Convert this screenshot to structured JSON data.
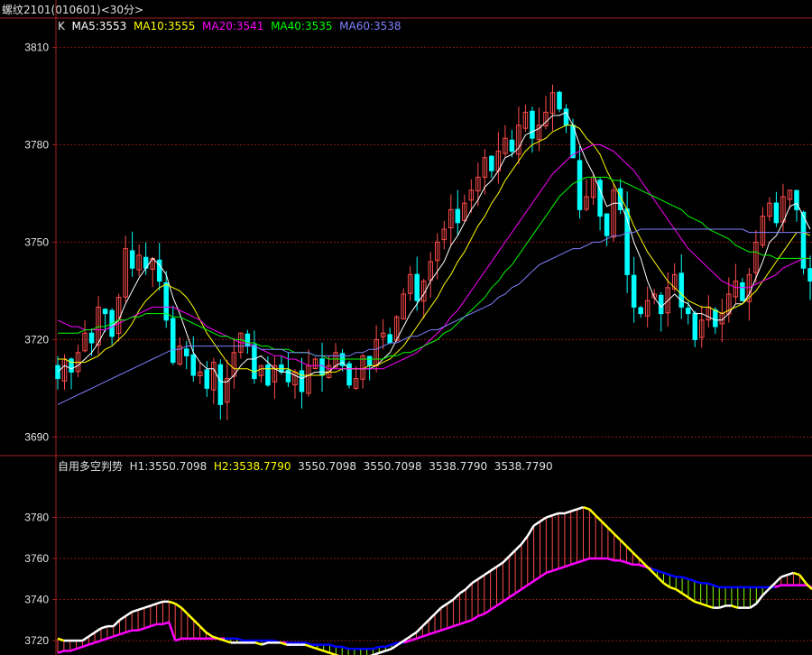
{
  "header": {
    "title": "螺纹2101(010601)<30分>"
  },
  "colors": {
    "up": "#ff4b4b",
    "down": "#00ffff",
    "grid": "#8b1a1a",
    "ma5": "#ffffff",
    "ma10": "#ffff00",
    "ma20": "#ff00ff",
    "ma40": "#00ff00",
    "ma60": "#8080ff"
  },
  "chart_data": [
    {
      "type": "candlestick",
      "legend": {
        "k": "K",
        "ma5": "MA5:3553",
        "ma10": "MA10:3555",
        "ma20": "MA20:3541",
        "ma40": "MA40:3535",
        "ma60": "MA60:3538"
      },
      "yticks": [
        "3810",
        "3780",
        "3750",
        "3720",
        "3690"
      ],
      "ylim": [
        3684,
        3819
      ],
      "close": [
        3708,
        3714,
        3710,
        3716,
        3722,
        3719,
        3730,
        3728,
        3721,
        3733,
        3748,
        3742,
        3746,
        3742,
        3745,
        3738,
        3726,
        3713,
        3718,
        3715,
        3709,
        3710,
        3705,
        3713,
        3700,
        3708,
        3716,
        3722,
        3718,
        3708,
        3712,
        3706,
        3712,
        3710,
        3707,
        3710,
        3704,
        3712,
        3714,
        3709,
        3712,
        3716,
        3712,
        3706,
        3708,
        3715,
        3712,
        3720,
        3722,
        3719,
        3727,
        3734,
        3740,
        3732,
        3738,
        3744,
        3750,
        3754,
        3760,
        3756,
        3762,
        3766,
        3770,
        3776,
        3772,
        3778,
        3782,
        3778,
        3786,
        3790,
        3782,
        3786,
        3790,
        3796,
        3791,
        3786,
        3776,
        3760,
        3764,
        3770,
        3758,
        3752,
        3766,
        3760,
        3740,
        3730,
        3728,
        3732,
        3734,
        3728,
        3736,
        3740,
        3730,
        3728,
        3720,
        3726,
        3730,
        3724,
        3728,
        3734,
        3738,
        3732,
        3740,
        3750,
        3758,
        3762,
        3756,
        3764,
        3766,
        3760,
        3742,
        3738
      ],
      "ma5": [
        3710,
        3712,
        3711,
        3712,
        3714,
        3716,
        3719,
        3723,
        3724,
        3726,
        3731,
        3735,
        3739,
        3742,
        3745,
        3743,
        3740,
        3733,
        3728,
        3722,
        3716,
        3713,
        3711,
        3711,
        3707,
        3707,
        3709,
        3712,
        3714,
        3714,
        3715,
        3713,
        3711,
        3710,
        3710,
        3709,
        3708,
        3709,
        3710,
        3710,
        3710,
        3712,
        3713,
        3711,
        3711,
        3711,
        3711,
        3712,
        3714,
        3716,
        3720,
        3724,
        3728,
        3731,
        3734,
        3738,
        3741,
        3744,
        3749,
        3752,
        3756,
        3760,
        3763,
        3767,
        3769,
        3772,
        3776,
        3777,
        3779,
        3783,
        3784,
        3785,
        3787,
        3789,
        3789,
        3790,
        3786,
        3780,
        3775,
        3771,
        3766,
        3761,
        3762,
        3762,
        3757,
        3750,
        3745,
        3738,
        3733,
        3730,
        3732,
        3734,
        3732,
        3731,
        3728,
        3728,
        3727,
        3726,
        3726,
        3728,
        3731,
        3731,
        3734,
        3739,
        3744,
        3750,
        3752,
        3756,
        3761,
        3762,
        3758,
        3754
      ],
      "ma10": [
        3714,
        3714,
        3713,
        3713,
        3713,
        3714,
        3715,
        3717,
        3718,
        3720,
        3722,
        3725,
        3729,
        3732,
        3734,
        3736,
        3737,
        3736,
        3735,
        3733,
        3730,
        3726,
        3722,
        3719,
        3716,
        3713,
        3711,
        3711,
        3711,
        3710,
        3711,
        3711,
        3711,
        3711,
        3711,
        3710,
        3709,
        3709,
        3709,
        3709,
        3710,
        3710,
        3711,
        3711,
        3711,
        3711,
        3712,
        3712,
        3713,
        3714,
        3716,
        3718,
        3721,
        3724,
        3727,
        3730,
        3733,
        3737,
        3740,
        3744,
        3747,
        3751,
        3755,
        3758,
        3762,
        3765,
        3769,
        3772,
        3775,
        3778,
        3780,
        3781,
        3782,
        3784,
        3785,
        3786,
        3786,
        3785,
        3782,
        3780,
        3777,
        3772,
        3768,
        3764,
        3760,
        3755,
        3751,
        3747,
        3744,
        3741,
        3738,
        3736,
        3734,
        3732,
        3731,
        3730,
        3730,
        3729,
        3728,
        3729,
        3730,
        3731,
        3733,
        3735,
        3738,
        3741,
        3744,
        3747,
        3750,
        3753,
        3753,
        3752
      ],
      "ma20": [
        3726,
        3725,
        3724,
        3724,
        3723,
        3723,
        3723,
        3723,
        3724,
        3725,
        3726,
        3727,
        3728,
        3729,
        3730,
        3730,
        3730,
        3730,
        3729,
        3728,
        3727,
        3726,
        3724,
        3723,
        3722,
        3721,
        3720,
        3719,
        3719,
        3718,
        3717,
        3716,
        3715,
        3715,
        3714,
        3714,
        3713,
        3712,
        3712,
        3712,
        3711,
        3711,
        3711,
        3711,
        3711,
        3711,
        3711,
        3711,
        3711,
        3712,
        3713,
        3714,
        3715,
        3716,
        3718,
        3720,
        3722,
        3724,
        3727,
        3729,
        3732,
        3735,
        3738,
        3741,
        3744,
        3747,
        3750,
        3753,
        3756,
        3759,
        3762,
        3765,
        3768,
        3771,
        3773,
        3775,
        3777,
        3778,
        3779,
        3780,
        3780,
        3779,
        3778,
        3776,
        3774,
        3772,
        3769,
        3766,
        3763,
        3760,
        3757,
        3754,
        3751,
        3748,
        3746,
        3744,
        3742,
        3740,
        3738,
        3737,
        3736,
        3736,
        3736,
        3737,
        3738,
        3739,
        3740,
        3742,
        3743,
        3744,
        3745,
        3745
      ],
      "ma40": [
        3722,
        3722,
        3722,
        3722,
        3723,
        3723,
        3724,
        3724,
        3725,
        3726,
        3726,
        3727,
        3727,
        3728,
        3728,
        3728,
        3728,
        3727,
        3727,
        3726,
        3725,
        3724,
        3723,
        3722,
        3721,
        3721,
        3720,
        3720,
        3719,
        3719,
        3718,
        3718,
        3717,
        3717,
        3717,
        3716,
        3716,
        3716,
        3715,
        3715,
        3714,
        3714,
        3714,
        3714,
        3714,
        3714,
        3714,
        3714,
        3714,
        3715,
        3715,
        3716,
        3716,
        3717,
        3718,
        3719,
        3720,
        3722,
        3723,
        3725,
        3727,
        3729,
        3731,
        3733,
        3736,
        3738,
        3741,
        3743,
        3746,
        3749,
        3752,
        3755,
        3758,
        3761,
        3764,
        3766,
        3768,
        3769,
        3770,
        3770,
        3770,
        3770,
        3769,
        3769,
        3768,
        3767,
        3766,
        3765,
        3764,
        3763,
        3762,
        3761,
        3760,
        3758,
        3757,
        3756,
        3754,
        3753,
        3752,
        3751,
        3749,
        3748,
        3747,
        3747,
        3746,
        3746,
        3745,
        3745,
        3745,
        3745,
        3745,
        3745
      ],
      "ma60": [
        3700,
        3701,
        3702,
        3703,
        3704,
        3705,
        3706,
        3707,
        3708,
        3709,
        3710,
        3711,
        3712,
        3713,
        3714,
        3715,
        3716,
        3717,
        3717,
        3718,
        3718,
        3718,
        3718,
        3718,
        3718,
        3718,
        3718,
        3718,
        3718,
        3718,
        3717,
        3717,
        3717,
        3717,
        3716,
        3716,
        3716,
        3716,
        3715,
        3715,
        3715,
        3715,
        3715,
        3715,
        3716,
        3716,
        3717,
        3717,
        3718,
        3719,
        3719,
        3720,
        3721,
        3721,
        3722,
        3723,
        3723,
        3724,
        3725,
        3726,
        3727,
        3728,
        3729,
        3730,
        3731,
        3733,
        3734,
        3736,
        3737,
        3739,
        3741,
        3743,
        3744,
        3745,
        3746,
        3747,
        3748,
        3748,
        3749,
        3750,
        3750,
        3751,
        3752,
        3752,
        3753,
        3753,
        3754,
        3754,
        3754,
        3754,
        3754,
        3754,
        3754,
        3754,
        3754,
        3754,
        3754,
        3754,
        3754,
        3754,
        3754,
        3754,
        3753,
        3753,
        3753,
        3753,
        3753,
        3753,
        3753,
        3753,
        3753,
        3753
      ]
    },
    {
      "type": "line",
      "legend": {
        "name": "自用多空判势",
        "h1": "H1:3550.7098",
        "h2": "H2:3538.7790",
        "v1": "3550.7098",
        "v2": "3550.7098",
        "v3": "3538.7790",
        "v4": "3538.7790"
      },
      "yticks": [
        "3780",
        "3760",
        "3740",
        "3720"
      ],
      "ylim": [
        3713,
        3800
      ],
      "h1": [
        3721,
        3720,
        3720,
        3720,
        3720,
        3722,
        3724,
        3726,
        3727,
        3727,
        3730,
        3732,
        3734,
        3735,
        3736,
        3737,
        3738,
        3739,
        3739,
        3738,
        3736,
        3733,
        3730,
        3727,
        3724,
        3722,
        3721,
        3720,
        3719,
        3719,
        3719,
        3719,
        3719,
        3718,
        3719,
        3719,
        3719,
        3718,
        3718,
        3718,
        3718,
        3717,
        3716,
        3715,
        3714,
        3713,
        3712,
        3712,
        3711,
        3712,
        3712,
        3713,
        3714,
        3715,
        3716,
        3718,
        3720,
        3722,
        3724,
        3727,
        3730,
        3733,
        3736,
        3738,
        3740,
        3743,
        3745,
        3748,
        3750,
        3752,
        3754,
        3756,
        3758,
        3761,
        3764,
        3767,
        3771,
        3776,
        3778,
        3780,
        3781,
        3782,
        3782,
        3783,
        3784,
        3785,
        3784,
        3781,
        3778,
        3775,
        3772,
        3769,
        3766,
        3763,
        3760,
        3757,
        3754,
        3751,
        3748,
        3746,
        3745,
        3743,
        3741,
        3739,
        3738,
        3737,
        3736,
        3736,
        3737,
        3737,
        3736,
        3736,
        3736,
        3738,
        3742,
        3745,
        3748,
        3751,
        3752,
        3753,
        3752,
        3748,
        3745
      ],
      "h2": [
        3714,
        3715,
        3715,
        3716,
        3717,
        3718,
        3719,
        3720,
        3721,
        3722,
        3723,
        3724,
        3725,
        3725,
        3726,
        3727,
        3728,
        3728,
        3729,
        3720,
        3721,
        3721,
        3721,
        3721,
        3721,
        3721,
        3721,
        3721,
        3721,
        3721,
        3720,
        3720,
        3720,
        3720,
        3720,
        3720,
        3719,
        3719,
        3719,
        3719,
        3719,
        3718,
        3718,
        3718,
        3718,
        3717,
        3717,
        3716,
        3716,
        3716,
        3716,
        3716,
        3717,
        3717,
        3718,
        3719,
        3719,
        3720,
        3721,
        3722,
        3723,
        3724,
        3725,
        3726,
        3727,
        3728,
        3729,
        3730,
        3732,
        3733,
        3735,
        3737,
        3739,
        3741,
        3743,
        3745,
        3747,
        3749,
        3751,
        3753,
        3754,
        3755,
        3756,
        3757,
        3758,
        3759,
        3760,
        3760,
        3760,
        3760,
        3759,
        3759,
        3758,
        3757,
        3757,
        3756,
        3755,
        3754,
        3753,
        3752,
        3751,
        3751,
        3750,
        3749,
        3748,
        3748,
        3747,
        3746,
        3746,
        3746,
        3746,
        3746,
        3746,
        3746,
        3746,
        3746,
        3746,
        3747,
        3747,
        3747,
        3747,
        3747,
        3746
      ]
    }
  ]
}
